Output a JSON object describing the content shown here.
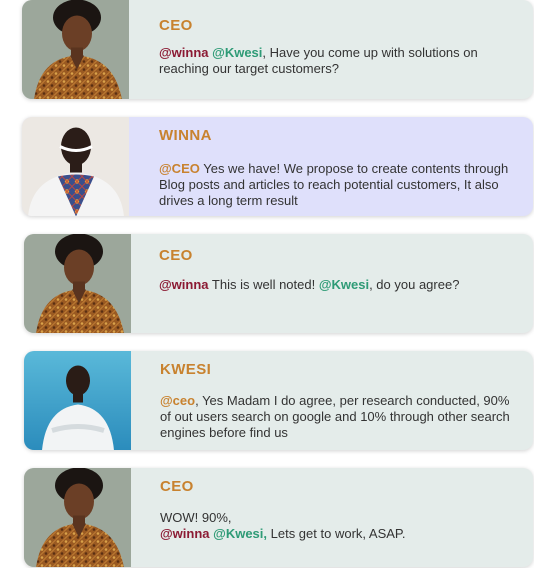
{
  "colors": {
    "ceo_card_bg": "#e4ecea",
    "winna_card_bg": "#dfe0fb",
    "name_color": "#c8822f",
    "mention_red": "#8b1a33",
    "mention_green": "#2e9b76",
    "mention_orange": "#c8822f"
  },
  "messages": [
    {
      "sender": "CEO",
      "avatar": "ceo-avatar",
      "parts": {
        "m1": "@winna",
        "m2": "@Kwesi",
        "t1": ", Have you come up with solutions on reaching our target customers?"
      }
    },
    {
      "sender": "WINNA",
      "avatar": "winna-avatar",
      "parts": {
        "m1": "@CEO",
        "t1": " Yes we have! We propose to create contents through Blog posts and articles to reach potential customers, It also drives a long term result"
      }
    },
    {
      "sender": "CEO",
      "avatar": "ceo-avatar",
      "parts": {
        "m1": "@winna",
        "t1": " This is well noted! ",
        "m2": "@Kwesi",
        "t2": ", do you agree?"
      }
    },
    {
      "sender": "KWESI",
      "avatar": "kwesi-avatar",
      "parts": {
        "m1": "@ceo",
        "t1": ", Yes Madam I do agree, per research conducted, 90% of out users search on google and 10% through other search engines before find us"
      }
    },
    {
      "sender": "CEO",
      "avatar": "ceo-avatar",
      "parts": {
        "line1": "WOW! 90%,",
        "m1": "@winna",
        "m2": "@Kwesi,",
        "t1": " Lets get to work, ASAP."
      }
    }
  ]
}
